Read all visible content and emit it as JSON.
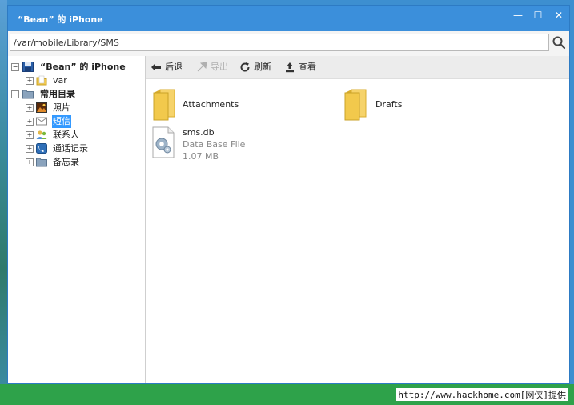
{
  "window": {
    "title": "“Bean” 的 iPhone",
    "controls": {
      "minimize": "—",
      "maximize": "☐",
      "close": "✕"
    }
  },
  "path": {
    "value": "/var/mobile/Library/SMS"
  },
  "tree": {
    "device": "“Bean” 的 iPhone",
    "var": "var",
    "common": "常用目录",
    "photos": "照片",
    "sms": "短信",
    "contacts": "联系人",
    "calls": "通话记录",
    "notes": "备忘录",
    "collapsed_glyph": "+",
    "expanded_glyph": "−"
  },
  "toolbar": {
    "back": "后退",
    "export": "导出",
    "refresh": "刷新",
    "view": "查看"
  },
  "files": [
    {
      "name": "Attachments",
      "icon": "folder-icon"
    },
    {
      "name": "Drafts",
      "icon": "folder-icon"
    },
    {
      "name": "sms.db",
      "type": "Data Base File",
      "size": "1.07 MB",
      "icon": "database-file-icon"
    }
  ],
  "footer": {
    "credit": "http://www.hackhome.com[网侠]提供"
  },
  "colors": {
    "titlebar": "#3b8fdb",
    "selection": "#3399ff",
    "footer": "#2ea24a",
    "folder": "#f2c94c"
  }
}
